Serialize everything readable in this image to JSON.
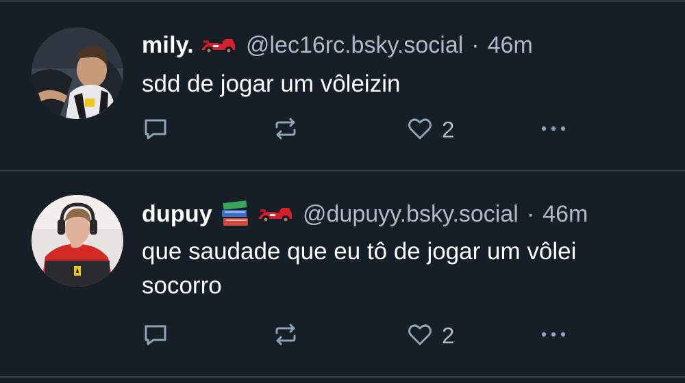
{
  "posts": [
    {
      "display_name": "mily.",
      "emojis": [
        "racing-car"
      ],
      "handle": "@lec16rc.bsky.social",
      "separator": "·",
      "time": "46m",
      "text": "sdd de jogar um vôleizin",
      "like_count": "2",
      "avatar": "avatar-driver-cockpit"
    },
    {
      "display_name": "dupuy",
      "emojis": [
        "books",
        "racing-car"
      ],
      "handle": "@dupuyy.bsky.social",
      "separator": "·",
      "time": "46m",
      "text": "que saudade que eu tô de jogar um vôlei socorro",
      "like_count": "2",
      "avatar": "avatar-team-radio"
    }
  ],
  "icons": {
    "reply": "reply-icon",
    "repost": "repost-icon",
    "like": "heart-icon",
    "more": "more-options-icon"
  },
  "colors": {
    "background": "#161e27",
    "divider": "#2b3845",
    "text_primary": "#ffffff",
    "text_secondary": "#aebbc9",
    "icon": "#8fa3b8",
    "racing_car": "#d71f2b"
  }
}
